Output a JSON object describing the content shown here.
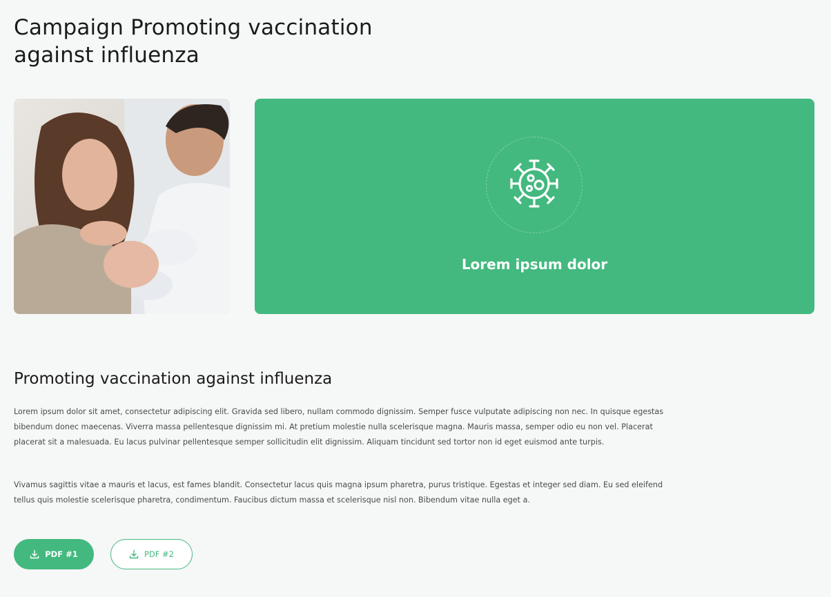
{
  "page": {
    "title": "Campaign Promoting vaccination against influenza"
  },
  "hero": {
    "photo_alt": "Doctor vaccinating a woman",
    "feature_icon": "virus-icon",
    "feature_label": "Lorem ipsum dolor",
    "accent_color": "#43b97f"
  },
  "content": {
    "heading": "Promoting vaccination against influenza",
    "paragraph_1": "Lorem ipsum dolor sit amet, consectetur adipiscing elit. Gravida sed libero, nullam commodo dignissim. Semper fusce vulputate adipiscing non nec. In quisque egestas bibendum donec maecenas. Viverra massa pellentesque dignissim mi. At pretium molestie nulla scelerisque magna. Mauris massa, semper odio eu non vel. Placerat placerat sit a malesuada. Eu lacus pulvinar pellentesque semper sollicitudin elit dignissim. Aliquam tincidunt sed tortor non id eget euismod ante turpis.",
    "paragraph_2": "Vivamus sagittis vitae a mauris et lacus, est fames blandit. Consectetur lacus quis magna ipsum pharetra, purus tristique. Egestas et integer sed diam. Eu sed eleifend tellus quis molestie scelerisque pharetra, condimentum. Faucibus dictum massa et scelerisque nisl non. Bibendum vitae nulla eget a."
  },
  "downloads": {
    "pdf1_label": "PDF #1",
    "pdf2_label": "PDF #2",
    "icon": "download-icon"
  }
}
